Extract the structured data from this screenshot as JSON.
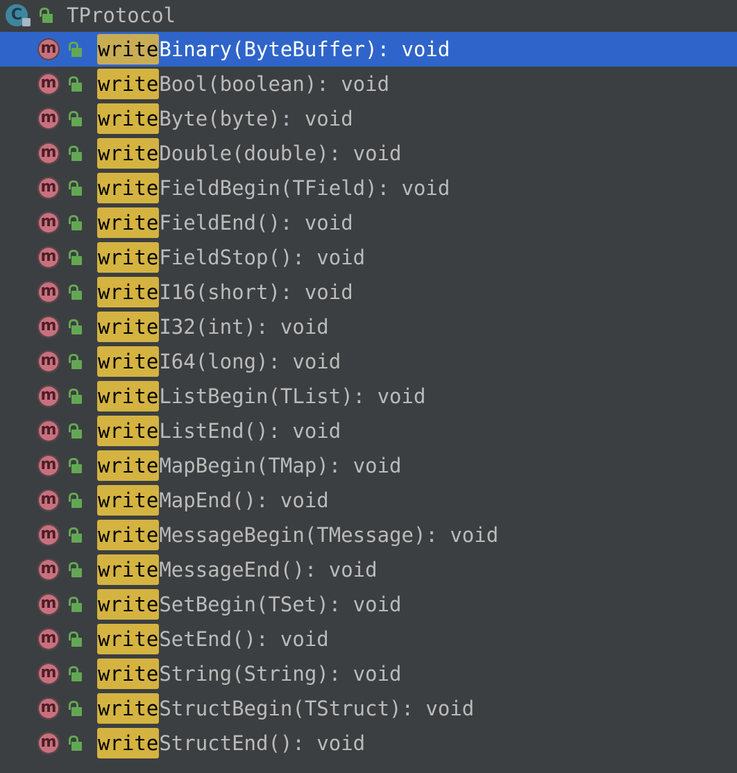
{
  "tree": {
    "class_node": {
      "icon": "class-icon",
      "icon_letter": "C",
      "visibility_icon": "lock-icon",
      "title": "TProtocol"
    },
    "highlight": "write",
    "method_icon_letter": "m",
    "methods": [
      {
        "rest": "Binary(ByteBuffer): void",
        "selected": true
      },
      {
        "rest": "Bool(boolean): void"
      },
      {
        "rest": "Byte(byte): void"
      },
      {
        "rest": "Double(double): void"
      },
      {
        "rest": "FieldBegin(TField): void"
      },
      {
        "rest": "FieldEnd(): void"
      },
      {
        "rest": "FieldStop(): void"
      },
      {
        "rest": "I16(short): void"
      },
      {
        "rest": "I32(int): void"
      },
      {
        "rest": "I64(long): void"
      },
      {
        "rest": "ListBegin(TList): void"
      },
      {
        "rest": "ListEnd(): void"
      },
      {
        "rest": "MapBegin(TMap): void"
      },
      {
        "rest": "MapEnd(): void"
      },
      {
        "rest": "MessageBegin(TMessage): void"
      },
      {
        "rest": "MessageEnd(): void"
      },
      {
        "rest": "SetBegin(TSet): void"
      },
      {
        "rest": "SetEnd(): void"
      },
      {
        "rest": "String(String): void"
      },
      {
        "rest": "StructBegin(TStruct): void"
      },
      {
        "rest": "StructEnd(): void"
      }
    ],
    "colors": {
      "background": "#3c3f41",
      "selection": "#2f65ca",
      "match_highlight": "#d4b341",
      "method_icon": "#c8707e",
      "class_icon": "#3e86a0",
      "lock": "#62a853"
    }
  }
}
